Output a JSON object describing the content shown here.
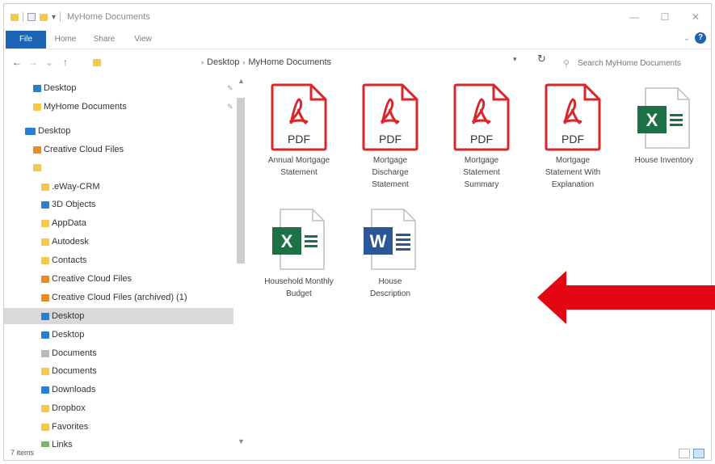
{
  "window": {
    "title": "MyHome Documents",
    "controls": {
      "minimize": "—",
      "maximize": "☐",
      "close": "✕"
    }
  },
  "ribbon": {
    "file_tab": "File",
    "tabs": [
      "Home",
      "Share",
      "View"
    ]
  },
  "address_bar": {
    "breadcrumb": [
      "Desktop",
      "MyHome Documents"
    ],
    "search_placeholder": "Search MyHome Documents"
  },
  "sidebar": {
    "items": [
      {
        "label": "Desktop",
        "icon": "desktop-folder-icon",
        "pinned": true
      },
      {
        "label": "MyHome Documents",
        "icon": "folder-icon",
        "pinned": true
      },
      {
        "label": "Desktop",
        "icon": "desktop-icon"
      },
      {
        "label": "Creative Cloud Files",
        "icon": "creative-cloud-folder-icon"
      },
      {
        "label": "",
        "icon": "user-folder-icon"
      },
      {
        "label": ".eWay-CRM",
        "icon": "folder-icon"
      },
      {
        "label": "3D Objects",
        "icon": "3d-objects-icon"
      },
      {
        "label": "AppData",
        "icon": "folder-icon"
      },
      {
        "label": "Autodesk",
        "icon": "folder-icon"
      },
      {
        "label": "Contacts",
        "icon": "contacts-folder-icon"
      },
      {
        "label": "Creative Cloud Files",
        "icon": "creative-cloud-folder-icon"
      },
      {
        "label": "Creative Cloud Files (archived) (1)",
        "icon": "creative-cloud-folder-icon"
      },
      {
        "label": "Desktop",
        "icon": "desktop-folder-icon",
        "selected": true
      },
      {
        "label": "Desktop",
        "icon": "desktop-folder-icon"
      },
      {
        "label": "Documents",
        "icon": "documents-folder-icon"
      },
      {
        "label": "Documents",
        "icon": "folder-icon"
      },
      {
        "label": "Downloads",
        "icon": "downloads-folder-icon"
      },
      {
        "label": "Dropbox",
        "icon": "folder-icon"
      },
      {
        "label": "Favorites",
        "icon": "favorites-folder-icon"
      },
      {
        "label": "Links",
        "icon": "links-folder-icon"
      }
    ]
  },
  "files": [
    {
      "name": "Annual Mortgage Statement",
      "type": "pdf",
      "badge": "PDF"
    },
    {
      "name": "Mortgage Discharge Statement",
      "type": "pdf",
      "badge": "PDF"
    },
    {
      "name": "Mortgage Statement Summary",
      "type": "pdf",
      "badge": "PDF"
    },
    {
      "name": "Mortgage Statement With Explanation",
      "type": "pdf",
      "badge": "PDF"
    },
    {
      "name": "House Inventory",
      "type": "excel",
      "badge": "X"
    },
    {
      "name": "Household Monthly Budget",
      "type": "excel",
      "badge": "X"
    },
    {
      "name": "House Description",
      "type": "word",
      "badge": "W"
    }
  ],
  "status_bar": {
    "item_count": "7 items"
  },
  "colors": {
    "accent": "#1a63b5",
    "pdf_red": "#d9262b",
    "excel_green": "#1e7145",
    "word_blue": "#2b5797",
    "arrow_red": "#e30613",
    "selection": "#d9d9d9"
  }
}
